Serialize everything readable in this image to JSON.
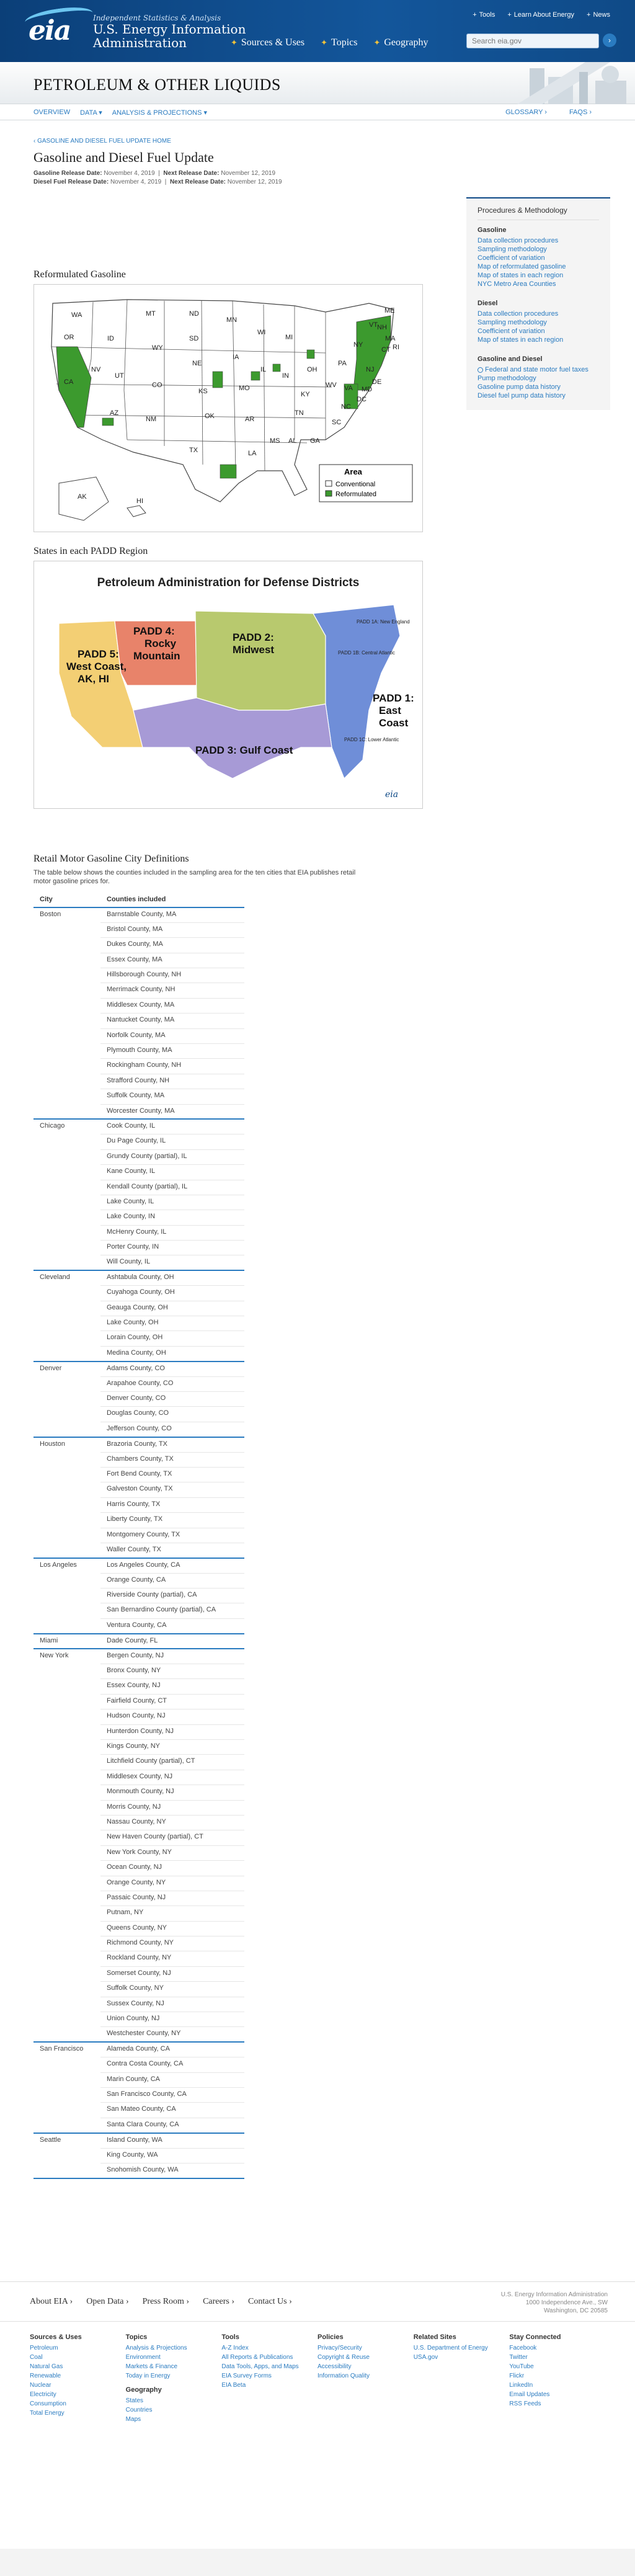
{
  "header": {
    "tagline": "Independent Statistics & Analysis",
    "agency_line1": "U.S. Energy Information",
    "agency_line2": "Administration",
    "utility": [
      "Tools",
      "Learn About Energy",
      "News"
    ],
    "nav": [
      "Sources & Uses",
      "Topics",
      "Geography"
    ],
    "search_placeholder": "Search eia.gov"
  },
  "section": {
    "title": "PETROLEUM & OTHER LIQUIDS",
    "subnav_left": [
      "OVERVIEW",
      "DATA ▾",
      "ANALYSIS & PROJECTIONS ▾"
    ],
    "subnav_right": [
      "GLOSSARY ›",
      "FAQS ›"
    ]
  },
  "page": {
    "breadcrumb": "‹ GASOLINE AND DIESEL FUEL UPDATE HOME",
    "title": "Gasoline and Diesel Fuel Update",
    "gas_release_label": "Gasoline Release Date:",
    "gas_release": "November 4, 2019",
    "gas_next_label": "Next Release Date:",
    "gas_next": "November 12, 2019",
    "diesel_release_label": "Diesel Fuel Release Date:",
    "diesel_release": "November 4, 2019",
    "diesel_next_label": "Next Release Date:",
    "diesel_next": "November 12, 2019"
  },
  "reformulated": {
    "heading": "Reformulated Gasoline",
    "legend_title": "Area",
    "legend_items": [
      "Conventional",
      "Reformulated"
    ],
    "conventional_color": "#ffffff",
    "reformulated_color": "#3c9a2e",
    "states": [
      "WA",
      "OR",
      "CA",
      "NV",
      "ID",
      "MT",
      "WY",
      "UT",
      "AZ",
      "CO",
      "NM",
      "ND",
      "SD",
      "NE",
      "KS",
      "OK",
      "TX",
      "MN",
      "IA",
      "MO",
      "AR",
      "LA",
      "WI",
      "IL",
      "MI",
      "IN",
      "OH",
      "KY",
      "TN",
      "MS",
      "AL",
      "GA",
      "FL",
      "SC",
      "NC",
      "VA",
      "WV",
      "PA",
      "NY",
      "ME",
      "NH",
      "VT",
      "MA",
      "CT",
      "RI",
      "NJ",
      "DE",
      "MD",
      "DC",
      "AK",
      "HI"
    ]
  },
  "padd": {
    "heading": "States in each PADD Region",
    "map_title": "Petroleum Administration for Defense Districts",
    "regions": [
      {
        "label": "PADD 5:",
        "label2": "West Coast,",
        "label3": "AK, HI",
        "color": "#f3cf74"
      },
      {
        "label": "PADD 4:",
        "label2": "Rocky",
        "label3": "Mountain",
        "color": "#e8836a"
      },
      {
        "label": "PADD 2:",
        "label2": "Midwest",
        "label3": "",
        "color": "#b8c96e"
      },
      {
        "label": "PADD 1:",
        "label2": "East",
        "label3": "Coast",
        "color": "#6f8ed8"
      },
      {
        "label": "PADD 3: Gulf Coast",
        "label2": "",
        "label3": "",
        "color": "#a79ad6"
      }
    ],
    "sub_labels": [
      "PADD 1A: New England",
      "PADD 1B: Central Atlantic",
      "PADD 1C: Lower Atlantic"
    ]
  },
  "cities": {
    "heading": "Retail Motor Gasoline City Definitions",
    "intro": "The table below shows the counties included in the sampling area for the ten cities that EIA publishes retail motor gasoline prices for.",
    "col_city": "City",
    "col_counties": "Counties included",
    "groups": [
      {
        "city": "Boston",
        "counties": [
          "Barnstable County, MA",
          "Bristol County, MA",
          "Dukes County, MA",
          "Essex County, MA",
          "Hillsborough County, NH",
          "Merrimack County, NH",
          "Middlesex County, MA",
          "Nantucket County, MA",
          "Norfolk County, MA",
          "Plymouth County, MA",
          "Rockingham County, NH",
          "Strafford County, NH",
          "Suffolk County, MA",
          "Worcester County, MA"
        ]
      },
      {
        "city": "Chicago",
        "counties": [
          "Cook County, IL",
          "Du Page County, IL",
          "Grundy County (partial), IL",
          "Kane County, IL",
          "Kendall County (partial), IL",
          "Lake County, IL",
          "Lake County, IN",
          "McHenry County, IL",
          "Porter County, IN",
          "Will County, IL"
        ]
      },
      {
        "city": "Cleveland",
        "counties": [
          "Ashtabula County, OH",
          "Cuyahoga County, OH",
          "Geauga County, OH",
          "Lake County, OH",
          "Lorain County, OH",
          "Medina County, OH"
        ]
      },
      {
        "city": "Denver",
        "counties": [
          "Adams County, CO",
          "Arapahoe County, CO",
          "Denver County, CO",
          "Douglas County, CO",
          "Jefferson County, CO"
        ]
      },
      {
        "city": "Houston",
        "counties": [
          "Brazoria County, TX",
          "Chambers County, TX",
          "Fort Bend County, TX",
          "Galveston County, TX",
          "Harris County, TX",
          "Liberty County, TX",
          "Montgomery County, TX",
          "Waller County, TX"
        ]
      },
      {
        "city": "Los Angeles",
        "counties": [
          "Los Angeles County, CA",
          "Orange County, CA",
          "Riverside County (partial), CA",
          "San Bernardino County (partial), CA",
          "Ventura County, CA"
        ]
      },
      {
        "city": "Miami",
        "counties": [
          "Dade County, FL"
        ]
      },
      {
        "city": "New York",
        "counties": [
          "Bergen County, NJ",
          "Bronx County, NY",
          "Essex County, NJ",
          "Fairfield County, CT",
          "Hudson County, NJ",
          "Hunterdon County, NJ",
          "Kings County, NY",
          "Litchfield County (partial), CT",
          "Middlesex County, NJ",
          "Monmouth County, NJ",
          "Morris County, NJ",
          "Nassau County, NY",
          "New Haven County (partial), CT",
          "New York County, NY",
          "Ocean County, NJ",
          "Orange County, NY",
          "Passaic County, NJ",
          "Putnam, NY",
          "Queens County, NY",
          "Richmond County, NY",
          "Rockland County, NY",
          "Somerset County, NJ",
          "Suffolk County, NY",
          "Sussex County, NJ",
          "Union County, NJ",
          "Westchester County, NY"
        ]
      },
      {
        "city": "San Francisco",
        "counties": [
          "Alameda County, CA",
          "Contra Costa County, CA",
          "Marin County, CA",
          "San Francisco County, CA",
          "San Mateo County, CA",
          "Santa Clara County, CA"
        ]
      },
      {
        "city": "Seattle",
        "counties": [
          "Island County, WA",
          "King County, WA",
          "Snohomish County, WA"
        ]
      }
    ]
  },
  "sidebar": {
    "title": "Procedures & Methodology",
    "sections": [
      {
        "heading": "Gasoline",
        "links": [
          "Data collection procedures",
          "Sampling methodology",
          "Coefficient of variation",
          "Map of reformulated gasoline",
          "Map of states in each region",
          "NYC Metro Area Counties"
        ]
      },
      {
        "heading": "Diesel",
        "links": [
          "Data collection procedures",
          "Sampling methodology",
          "Coefficient of variation",
          "Map of states in each region"
        ]
      },
      {
        "heading": "Gasoline and Diesel",
        "links": [
          "Federal and state motor fuel taxes",
          "Pump methodology",
          "Gasoline pump data history",
          "Diesel fuel pump data history"
        ]
      }
    ]
  },
  "footer": {
    "links": [
      "About EIA ›",
      "Open Data ›",
      "Press Room ›",
      "Careers ›",
      "Contact Us ›"
    ],
    "address": [
      "U.S. Energy Information Administration",
      "1000 Independence Ave., SW",
      "Washington, DC 20585"
    ],
    "columns": [
      {
        "heading": "Sources & Uses",
        "links": [
          "Petroleum",
          "Coal",
          "Natural Gas",
          "Renewable",
          "Nuclear",
          "Electricity",
          "Consumption",
          "Total Energy"
        ]
      },
      {
        "heading": "Topics",
        "links": [
          "Analysis & Projections",
          "Environment",
          "Markets & Finance",
          "Today in Energy"
        ],
        "heading2": "Geography",
        "links2": [
          "States",
          "Countries",
          "Maps"
        ]
      },
      {
        "heading": "Tools",
        "links": [
          "A-Z Index",
          "All Reports & Publications",
          "Data Tools, Apps, and Maps",
          "EIA Survey Forms",
          "EIA Beta"
        ]
      },
      {
        "heading": "Policies",
        "links": [
          "Privacy/Security",
          "Copyright & Reuse",
          "Accessibility",
          "Information Quality"
        ]
      },
      {
        "heading": "Related Sites",
        "links": [
          "U.S. Department of Energy",
          "USA.gov"
        ]
      },
      {
        "heading": "Stay Connected",
        "links": [
          "Facebook",
          "Twitter",
          "YouTube",
          "Flickr",
          "LinkedIn",
          "Email Updates",
          "RSS Feeds"
        ]
      }
    ]
  }
}
